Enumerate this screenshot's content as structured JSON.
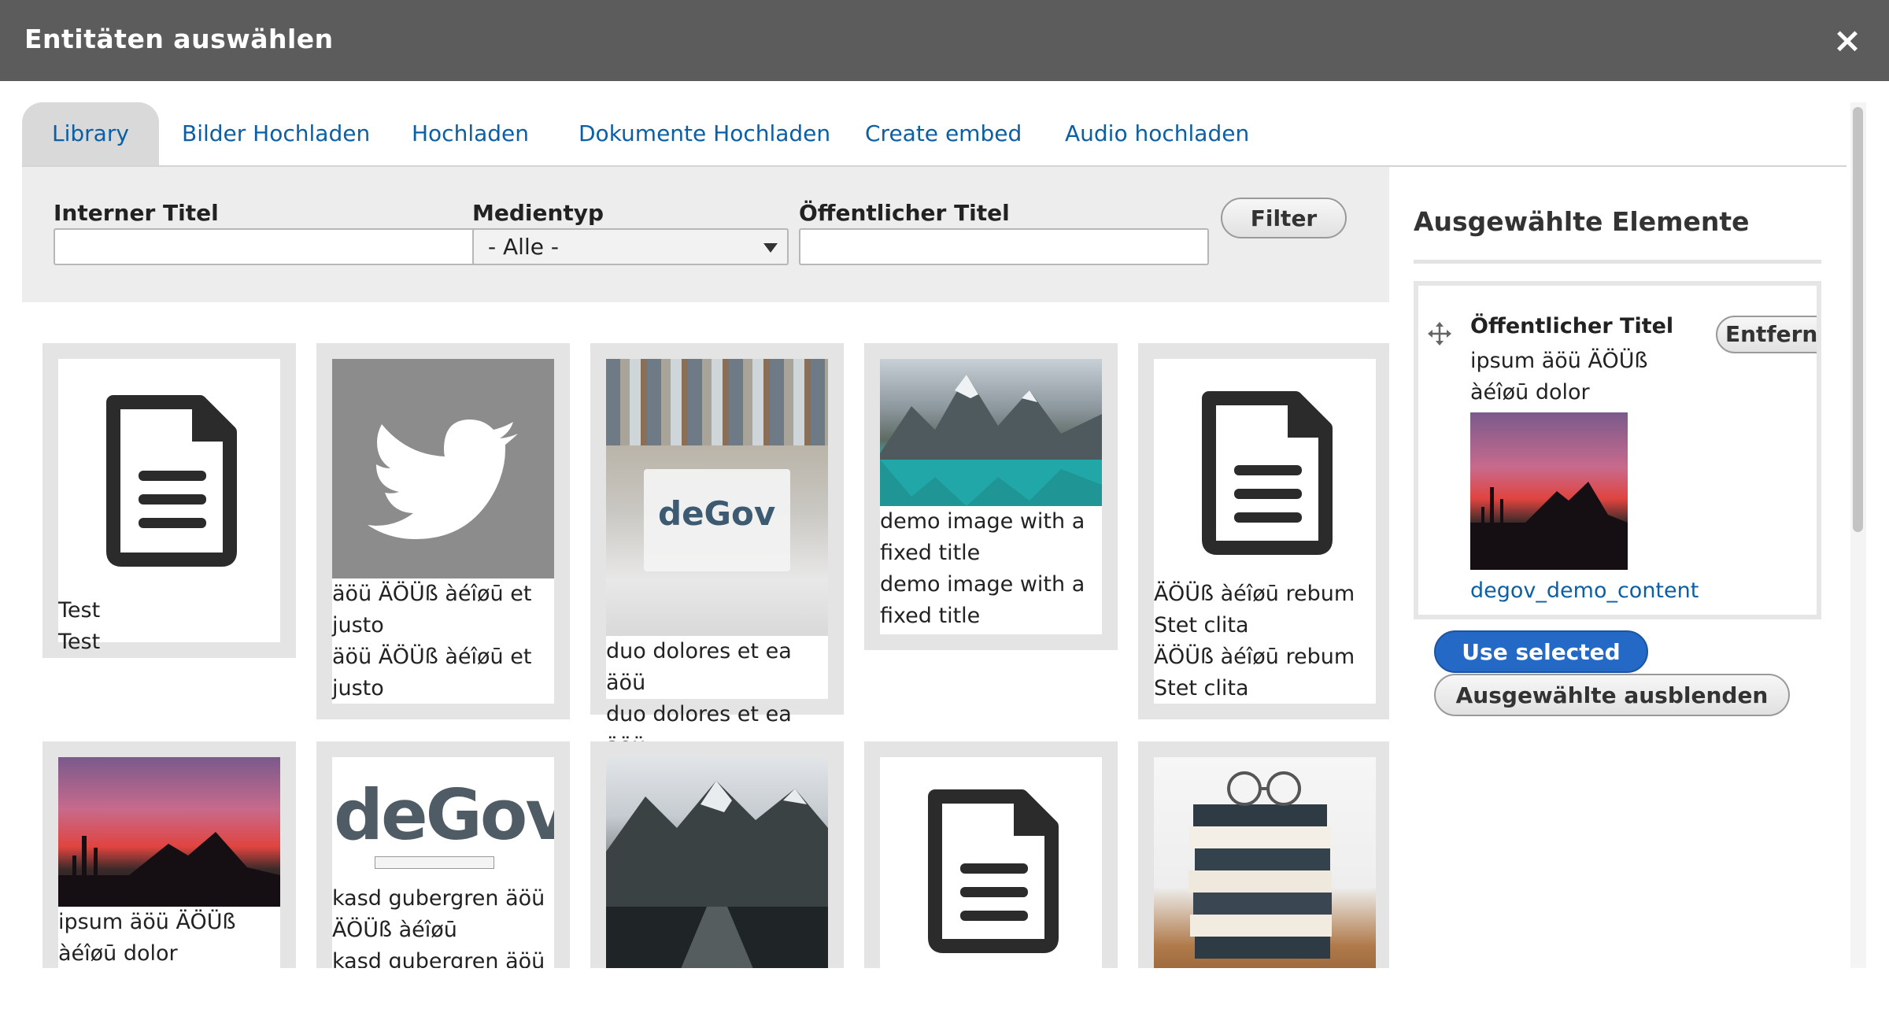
{
  "dialog": {
    "title": "Entitäten auswählen",
    "close_symbol": "×"
  },
  "tabs": [
    {
      "label": "Library",
      "active": true
    },
    {
      "label": "Bilder Hochladen",
      "active": false
    },
    {
      "label": "Hochladen",
      "active": false
    },
    {
      "label": "Dokumente Hochladen",
      "active": false
    },
    {
      "label": "Create embed",
      "active": false
    },
    {
      "label": "Audio hochladen",
      "active": false
    }
  ],
  "filters": {
    "internal_title_label": "Interner Titel",
    "internal_title_value": "",
    "media_type_label": "Medientyp",
    "media_type_value": "- Alle -",
    "public_title_label": "Öffentlicher Titel",
    "public_title_value": "",
    "filter_button": "Filter"
  },
  "media": [
    {
      "thumb": "document-icon",
      "caption1": "Test",
      "caption2": "Test"
    },
    {
      "thumb": "twitter-bird-icon",
      "caption1": "äöü ÄÖÜß àéîøū et justo",
      "caption2": "äöü ÄÖÜß àéîøū et justo"
    },
    {
      "thumb": "degov-banner-photo",
      "thumb_text": "deGov",
      "caption1": "duo dolores et ea äöü",
      "caption2": "duo dolores et ea äöü"
    },
    {
      "thumb": "mountain-lake-photo",
      "caption1": "demo image with a fixed title",
      "caption2": "demo image with a fixed title"
    },
    {
      "thumb": "document-icon",
      "caption1": "ÄÖÜß àéîøū rebum Stet clita",
      "caption2": "ÄÖÜß àéîøū rebum Stet clita"
    },
    {
      "thumb": "sunset-photo",
      "caption1": "ipsum äöü ÄÖÜß àéîøū dolor",
      "caption2": ""
    },
    {
      "thumb": "degov-logo",
      "thumb_text": "deGov",
      "caption1": "kasd gubergren äöü ÄÖÜß àéîøū",
      "caption2": "kasd gubergren äöü"
    },
    {
      "thumb": "mountain-road-photo",
      "caption1": "",
      "caption2": ""
    },
    {
      "thumb": "document-icon",
      "caption1": "",
      "caption2": ""
    },
    {
      "thumb": "books-glasses-photo",
      "caption1": "",
      "caption2": ""
    }
  ],
  "selection": {
    "heading": "Ausgewählte Elemente",
    "item": {
      "title": "Öffentlicher Titel",
      "description": "ipsum äöü ÄÖÜß àéîøū dolor",
      "thumb": "sunset-photo",
      "link": "degov_demo_content",
      "remove_label": "Entfernen"
    },
    "use_selected": "Use selected",
    "hide_selected": "Ausgewählte ausblenden"
  },
  "colors": {
    "header": "#5c5c5c",
    "link": "#0b5fa5",
    "primary_button": "#2369c5",
    "tab_active": "#d9d9d9",
    "filter_bg": "#ededed",
    "card_bg": "#e4e4e4"
  }
}
